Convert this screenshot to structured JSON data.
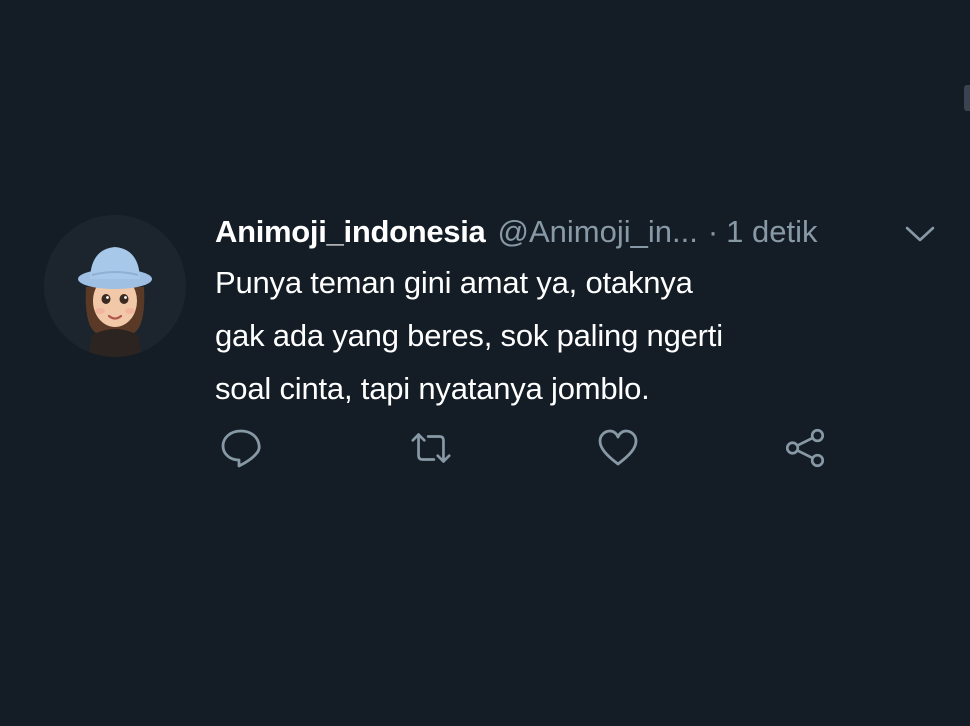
{
  "tweet": {
    "display_name": "Animoji_indonesia",
    "handle": "@Animoji_in...",
    "separator": "·",
    "time": "1 detik",
    "text_lines": [
      "Punya teman gini amat ya, otaknya",
      "gak ada yang beres, sok paling ngerti",
      "soal cinta, tapi nyatanya jomblo."
    ]
  },
  "icons": {
    "menu": "chevron-down-icon",
    "reply": "reply-icon",
    "retweet": "retweet-icon",
    "like": "heart-icon",
    "share": "share-icon"
  },
  "colors": {
    "background": "#141d26",
    "primary_text": "#ffffff",
    "secondary_text": "#8899a6"
  }
}
